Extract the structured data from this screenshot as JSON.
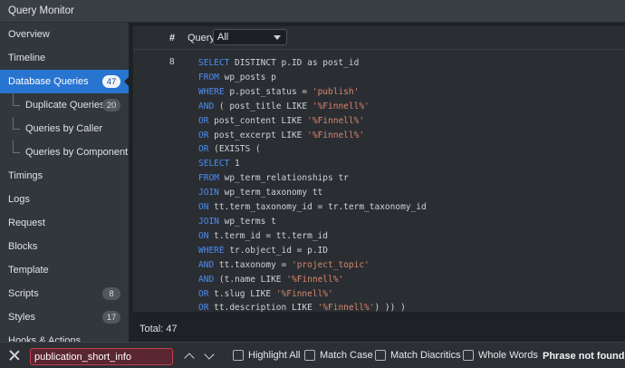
{
  "window": {
    "title": "Query Monitor"
  },
  "sidebar": {
    "items": [
      {
        "label": "Overview",
        "name": "sidebar-item-overview"
      },
      {
        "label": "Timeline",
        "name": "sidebar-item-timeline"
      },
      {
        "label": "Database Queries",
        "badge": "47",
        "active": true,
        "name": "sidebar-item-database-queries"
      },
      {
        "label": "Duplicate Queries",
        "badge": "20",
        "sub": true,
        "name": "sidebar-item-duplicate-queries"
      },
      {
        "label": "Queries by Caller",
        "sub": true,
        "name": "sidebar-item-queries-by-caller"
      },
      {
        "label": "Queries by Component",
        "sub": true,
        "name": "sidebar-item-queries-by-component"
      },
      {
        "label": "Timings",
        "name": "sidebar-item-timings"
      },
      {
        "label": "Logs",
        "name": "sidebar-item-logs"
      },
      {
        "label": "Request",
        "name": "sidebar-item-request"
      },
      {
        "label": "Blocks",
        "name": "sidebar-item-blocks"
      },
      {
        "label": "Template",
        "name": "sidebar-item-template"
      },
      {
        "label": "Scripts",
        "badge": "8",
        "name": "sidebar-item-scripts"
      },
      {
        "label": "Styles",
        "badge": "17",
        "name": "sidebar-item-styles"
      },
      {
        "label": "Hooks & Actions",
        "name": "sidebar-item-hooks-actions"
      }
    ]
  },
  "table": {
    "col_hash": "#",
    "col_query": "Query",
    "filter_value": "All",
    "row_number": "8",
    "query_lines": [
      [
        [
          "kw",
          "SELECT"
        ],
        [
          "t",
          " DISTINCT p.ID as post_id"
        ]
      ],
      [
        [
          "kw",
          "FROM"
        ],
        [
          "t",
          " wp_posts p"
        ]
      ],
      [
        [
          "kw",
          "WHERE"
        ],
        [
          "t",
          " p.post_status = "
        ],
        [
          "str",
          "'publish'"
        ]
      ],
      [
        [
          "kw",
          "AND"
        ],
        [
          "t",
          " ( post_title LIKE "
        ],
        [
          "str",
          "'%Finnell%'"
        ]
      ],
      [
        [
          "kw",
          "OR"
        ],
        [
          "t",
          " post_content LIKE "
        ],
        [
          "str",
          "'%Finnell%'"
        ]
      ],
      [
        [
          "kw",
          "OR"
        ],
        [
          "t",
          " post_excerpt LIKE "
        ],
        [
          "str",
          "'%Finnell%'"
        ]
      ],
      [
        [
          "kw",
          "OR"
        ],
        [
          "t",
          " (EXISTS ("
        ]
      ],
      [
        [
          "kw",
          "SELECT"
        ],
        [
          "t",
          " 1"
        ]
      ],
      [
        [
          "kw",
          "FROM"
        ],
        [
          "t",
          " wp_term_relationships tr"
        ]
      ],
      [
        [
          "kw",
          "JOIN"
        ],
        [
          "t",
          " wp_term_taxonomy tt"
        ]
      ],
      [
        [
          "kw",
          "ON"
        ],
        [
          "t",
          " tt.term_taxonomy_id = tr.term_taxonomy_id"
        ]
      ],
      [
        [
          "kw",
          "JOIN"
        ],
        [
          "t",
          " wp_terms t"
        ]
      ],
      [
        [
          "kw",
          "ON"
        ],
        [
          "t",
          " t.term_id = tt.term_id"
        ]
      ],
      [
        [
          "kw",
          "WHERE"
        ],
        [
          "t",
          " tr.object_id = p.ID"
        ]
      ],
      [
        [
          "kw",
          "AND"
        ],
        [
          "t",
          " tt.taxonomy = "
        ],
        [
          "str",
          "'project_topic'"
        ]
      ],
      [
        [
          "kw",
          "AND"
        ],
        [
          "t",
          " (t.name LIKE "
        ],
        [
          "str",
          "'%Finnell%'"
        ]
      ],
      [
        [
          "kw",
          "OR"
        ],
        [
          "t",
          " t.slug LIKE "
        ],
        [
          "str",
          "'%Finnell%'"
        ]
      ],
      [
        [
          "kw",
          "OR"
        ],
        [
          "t",
          " tt.description LIKE "
        ],
        [
          "str",
          "'%Finnell%'"
        ],
        [
          "t",
          ") )) )"
        ]
      ]
    ],
    "total": "Total: 47"
  },
  "findbar": {
    "value": "publication_short_info",
    "options": [
      "Highlight All",
      "Match Case",
      "Match Diacritics",
      "Whole Words"
    ],
    "status": "Phrase not found"
  }
}
